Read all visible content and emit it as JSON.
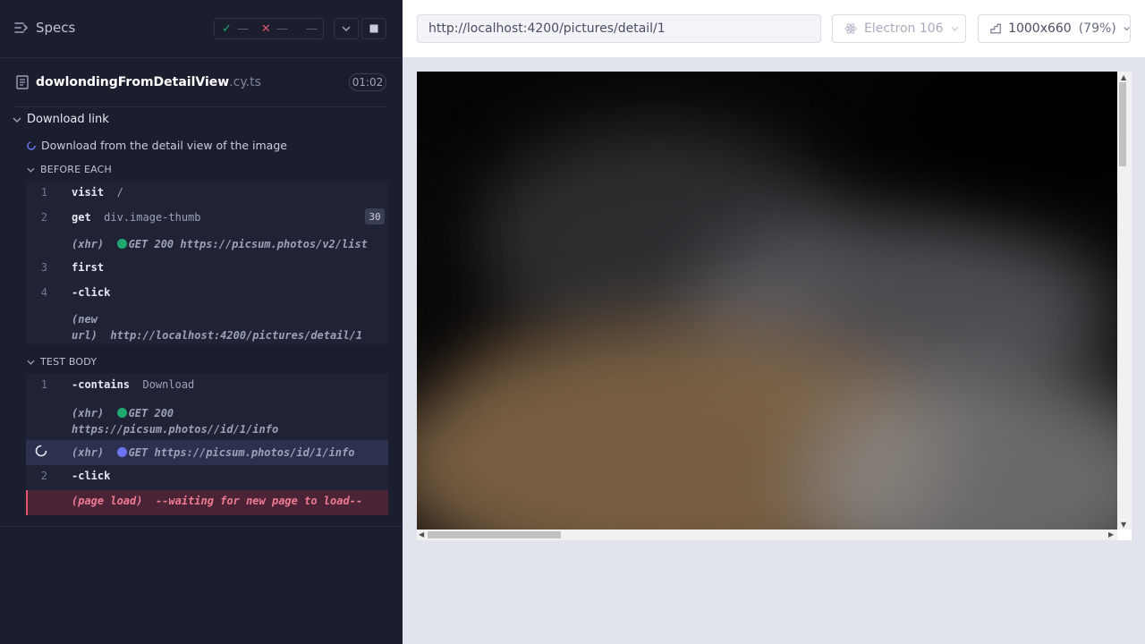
{
  "sidebar": {
    "specs_label": "Specs",
    "stats": {
      "passed": "—",
      "failed": "—",
      "pending": "—"
    },
    "file": {
      "name": "dowlondingFromDetailView",
      "ext": ".cy.ts",
      "duration": "01:02"
    }
  },
  "suite": {
    "title": "Download link"
  },
  "test": {
    "title": "Download from the detail view of the image"
  },
  "before_each": {
    "label": "BEFORE EACH",
    "commands": [
      {
        "num": "1",
        "name": "visit",
        "msg": "/"
      },
      {
        "num": "2",
        "name": "get",
        "msg": "div.image-thumb",
        "badge": "30"
      },
      {
        "kind": "(xhr)",
        "method": "GET 200 https://picsum.photos/v2/list"
      },
      {
        "num": "3",
        "name": "first"
      },
      {
        "num": "4",
        "name": "-click"
      },
      {
        "kind1": "(new",
        "kind2": "url)",
        "msg": "http://localhost:4200/pictures/detail/1"
      }
    ]
  },
  "test_body": {
    "label": "TEST BODY",
    "commands": [
      {
        "num": "1",
        "name": "-contains",
        "msg": "Download"
      },
      {
        "kind": "(xhr)",
        "method": "GET 200",
        "url": "https://picsum.photos//id/1/info"
      },
      {
        "kind": "(xhr)",
        "method": "GET https://picsum.photos/id/1/info"
      },
      {
        "num": "2",
        "name": "-click"
      },
      {
        "kind": "(page load)",
        "msg": "--waiting for new page to load--"
      }
    ]
  },
  "browser": {
    "url": "http://localhost:4200/pictures/detail/1",
    "name": "Electron 106",
    "viewport": "1000x660",
    "scale": "(79%)"
  },
  "colors": {
    "pass": "#1fa971",
    "fail": "#e45770",
    "pending_dot": "#6b74ee",
    "accent": "#1fa971"
  }
}
